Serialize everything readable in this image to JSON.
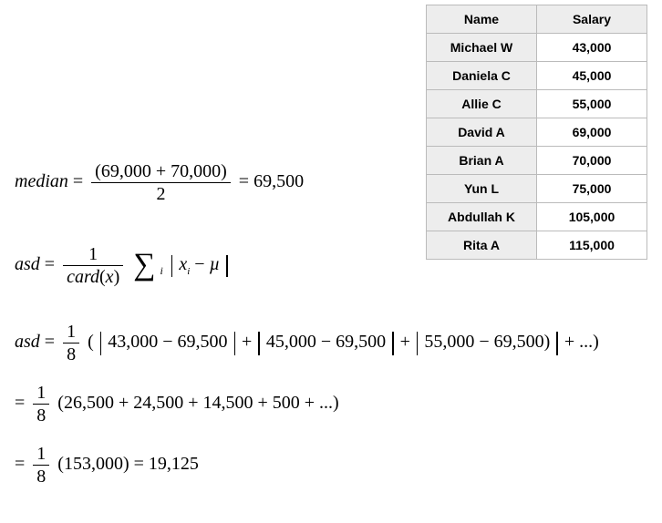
{
  "table": {
    "headers": {
      "name": "Name",
      "salary": "Salary"
    },
    "rows": [
      {
        "name": "Michael W",
        "salary": "43,000"
      },
      {
        "name": "Daniela C",
        "salary": "45,000"
      },
      {
        "name": "Allie C",
        "salary": "55,000"
      },
      {
        "name": "David A",
        "salary": "69,000"
      },
      {
        "name": "Brian A",
        "salary": "70,000"
      },
      {
        "name": "Yun L",
        "salary": "75,000"
      },
      {
        "name": "Abdullah K",
        "salary": "105,000"
      },
      {
        "name": "Rita A",
        "salary": "115,000"
      }
    ]
  },
  "eq_median": {
    "label": "median",
    "num": "(69,000 + 70,000)",
    "den": "2",
    "result": "69,500"
  },
  "eq_asd_formula": {
    "label": "asd",
    "num": "1",
    "den_prefix": "card",
    "den_inner": "x",
    "sum_var": "i",
    "term1": "x",
    "term1_sub": "i",
    "minus": "−",
    "term2": "µ"
  },
  "eq_asd_plugged": {
    "label": "asd",
    "frac_num": "1",
    "frac_den": "8",
    "t1a": "43,000",
    "t1b": "69,500",
    "t2a": "45,000",
    "t2b": "69,500",
    "t3a": "55,000",
    "t3b": "69,500",
    "tail": "+ ...)"
  },
  "eq_asd_diffs": {
    "frac_num": "1",
    "frac_den": "8",
    "inside": "(26,500 + 24,500 + 14,500 + 500 + ...)"
  },
  "eq_asd_final": {
    "frac_num": "1",
    "frac_den": "8",
    "paren": "(153,000)",
    "result": "19,125"
  },
  "glyph": {
    "eq": "=",
    "plus": "+",
    "minus": "−"
  }
}
